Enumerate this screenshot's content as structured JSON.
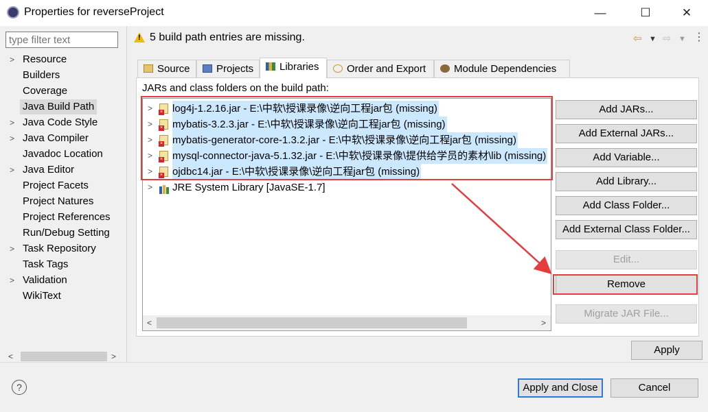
{
  "window": {
    "title": "Properties for reverseProject",
    "minimize_glyph": "—",
    "maximize_glyph": "☐",
    "close_glyph": "✕"
  },
  "filter": {
    "placeholder": "type filter text"
  },
  "nav": {
    "items": [
      {
        "label": "Resource",
        "expandable": true
      },
      {
        "label": "Builders",
        "expandable": false
      },
      {
        "label": "Coverage",
        "expandable": false
      },
      {
        "label": "Java Build Path",
        "expandable": false,
        "selected": true
      },
      {
        "label": "Java Code Style",
        "expandable": true
      },
      {
        "label": "Java Compiler",
        "expandable": true
      },
      {
        "label": "Javadoc Location",
        "expandable": false
      },
      {
        "label": "Java Editor",
        "expandable": true
      },
      {
        "label": "Project Facets",
        "expandable": false
      },
      {
        "label": "Project Natures",
        "expandable": false
      },
      {
        "label": "Project References",
        "expandable": false
      },
      {
        "label": "Run/Debug Setting",
        "expandable": false
      },
      {
        "label": "Task Repository",
        "expandable": true
      },
      {
        "label": "Task Tags",
        "expandable": false
      },
      {
        "label": "Validation",
        "expandable": true
      },
      {
        "label": "WikiText",
        "expandable": false
      }
    ]
  },
  "header": {
    "message": "5 build path entries are missing.",
    "warning_icon": "warning-icon"
  },
  "tabs": [
    {
      "label": "Source",
      "icon": "source-icon"
    },
    {
      "label": "Projects",
      "icon": "projects-icon"
    },
    {
      "label": "Libraries",
      "icon": "libraries-icon",
      "active": true
    },
    {
      "label": "Order and Export",
      "icon": "order-icon"
    },
    {
      "label": "Module Dependencies",
      "icon": "module-icon"
    }
  ],
  "panel": {
    "label": "JARs and class folders on the build path:",
    "entries": [
      {
        "text": "log4j-1.2.16.jar - E:\\中软\\授课录像\\逆向工程jar包 (missing)",
        "missing": true
      },
      {
        "text": "mybatis-3.2.3.jar - E:\\中软\\授课录像\\逆向工程jar包 (missing)",
        "missing": true
      },
      {
        "text": "mybatis-generator-core-1.3.2.jar - E:\\中软\\授课录像\\逆向工程jar包 (missing)",
        "missing": true
      },
      {
        "text": "mysql-connector-java-5.1.32.jar - E:\\中软\\授课录像\\提供给学员的素材\\lib (missing)",
        "missing": true
      },
      {
        "text": "ojdbc14.jar - E:\\中软\\授课录像\\逆向工程jar包 (missing)",
        "missing": true
      },
      {
        "text": "JRE System Library [JavaSE-1.7]",
        "missing": false
      }
    ]
  },
  "buttons": {
    "add_jars": "Add JARs...",
    "add_external_jars": "Add External JARs...",
    "add_variable": "Add Variable...",
    "add_library": "Add Library...",
    "add_class_folder": "Add Class Folder...",
    "add_external_class_folder": "Add External Class Folder...",
    "edit": "Edit...",
    "remove": "Remove",
    "migrate_jar": "Migrate JAR File...",
    "apply": "Apply",
    "apply_and_close": "Apply and Close",
    "cancel": "Cancel",
    "help": "?"
  },
  "colors": {
    "annotation_red": "#e53c3c",
    "selection_blue": "#cce8ff",
    "default_button_border": "#2a7bd6"
  }
}
